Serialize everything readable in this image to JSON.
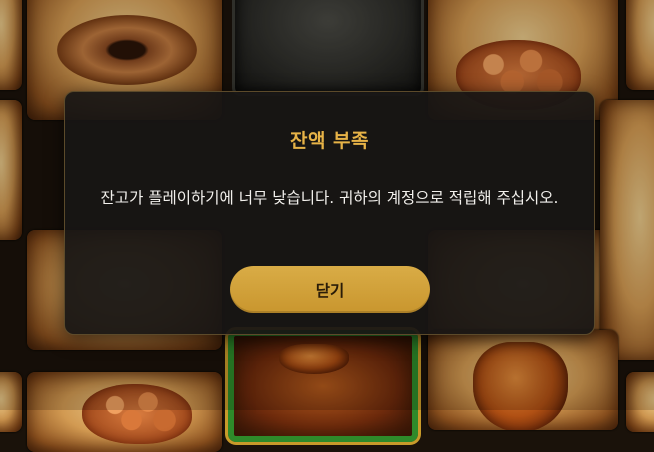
{
  "dialog": {
    "title": "잔액 부족",
    "message": "잔고가 플레이하기에 너무 낮습니다. 귀하의 계정으로 적립해 주십시오.",
    "close_label": "닫기"
  },
  "colors": {
    "title": "#e7b347",
    "button": "#d4a440",
    "panel": "#181614"
  },
  "symbols": [
    "eye-symbol",
    "cracked-stone-symbol",
    "brain-symbol",
    "heart-symbol",
    "framed-heart-symbol"
  ]
}
